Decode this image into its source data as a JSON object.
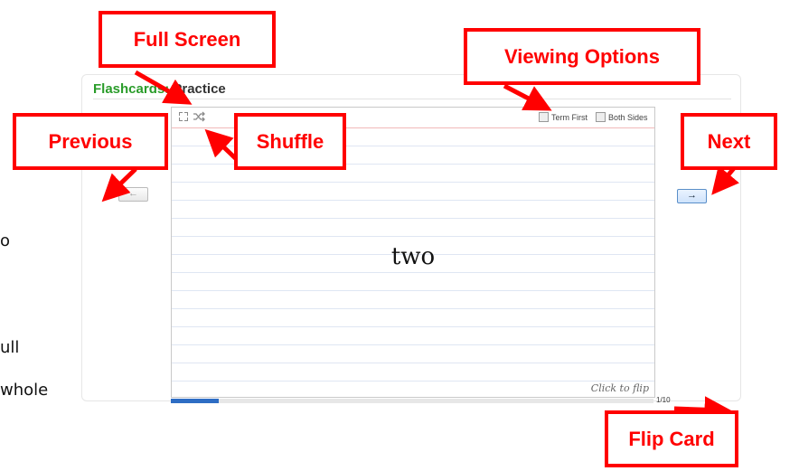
{
  "panel": {
    "title_prefix": "Flashcards:",
    "title_suffix": "Practice"
  },
  "side_text": [
    "o",
    "ull",
    "whole"
  ],
  "card": {
    "word": "two",
    "flip_hint": "Click to flip",
    "icons": {
      "fullscreen": "fullscreen-icon",
      "shuffle": "shuffle-icon"
    },
    "options": [
      {
        "label": "Term First",
        "checked": false
      },
      {
        "label": "Both Sides",
        "checked": false
      }
    ]
  },
  "progress": {
    "current": 1,
    "total": 10,
    "label": "1/10",
    "accent": "#2e6dc4"
  },
  "nav": {
    "prev_symbol": "←",
    "next_symbol": "→"
  },
  "callouts": {
    "full_screen": "Full Screen",
    "viewing_options": "Viewing Options",
    "previous": "Previous",
    "shuffle": "Shuffle",
    "next": "Next",
    "flip_card": "Flip Card"
  },
  "colors": {
    "callout": "#ff0000",
    "title_green": "#2a9c2a"
  }
}
